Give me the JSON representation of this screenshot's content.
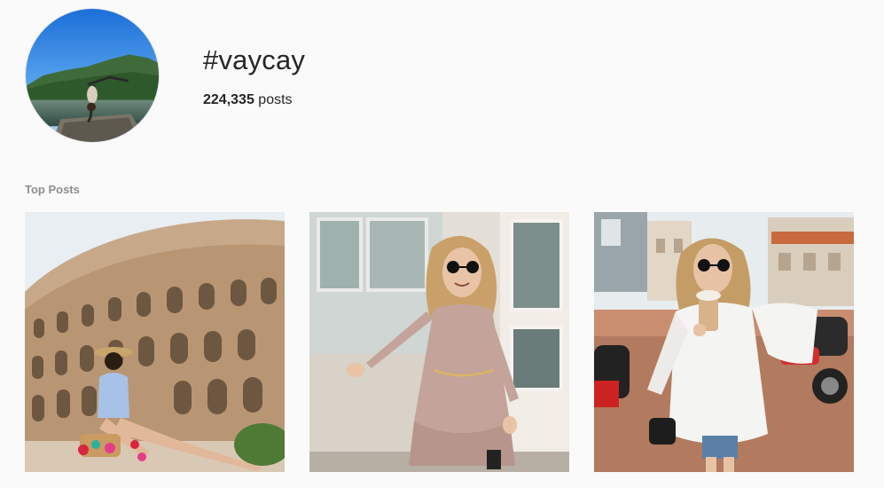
{
  "header": {
    "hashtag": "#vaycay",
    "post_count": "224,335",
    "post_suffix": " posts",
    "avatar_icon": "hashtag-cover-photo"
  },
  "top_posts": {
    "label": "Top Posts",
    "items": [
      {
        "id": "post-1",
        "icon": "colosseum-photo"
      },
      {
        "id": "post-2",
        "icon": "street-fashion-photo"
      },
      {
        "id": "post-3",
        "icon": "city-coffee-photo"
      }
    ]
  },
  "colors": {
    "background": "#fafafa",
    "text": "#262626",
    "muted": "#8e8e8e"
  }
}
